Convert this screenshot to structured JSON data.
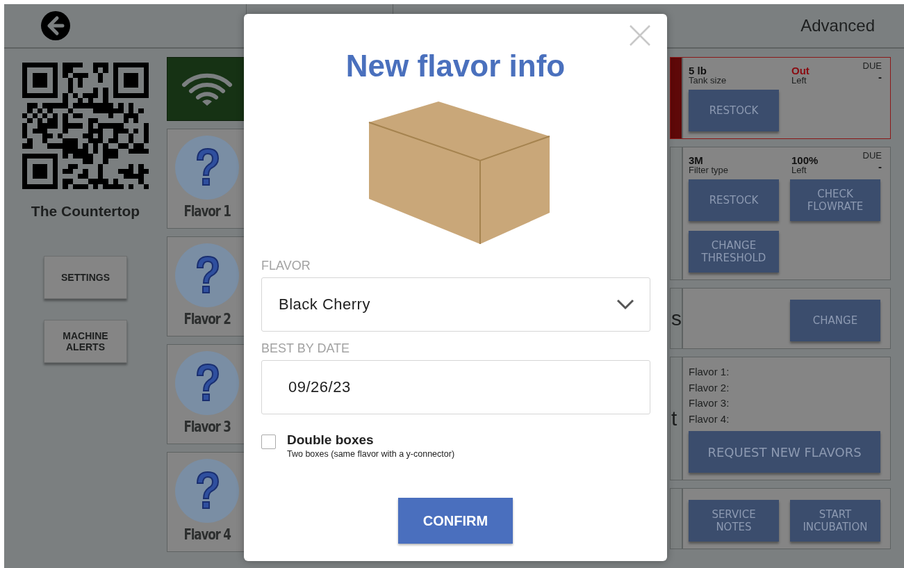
{
  "header": {
    "title": "Advanced"
  },
  "machine": {
    "name": "The Countertop"
  },
  "side_buttons": [
    "SETTINGS",
    "MACHINE ALERTS"
  ],
  "flavor_tiles": [
    {
      "label": "Flavor 1"
    },
    {
      "label": "Flavor 2"
    },
    {
      "label": "Flavor 3"
    },
    {
      "label": "Flavor 4"
    }
  ],
  "cards": [
    {
      "kind": "supply",
      "alert": true,
      "size": "5 lb",
      "size_label": "Tank size",
      "remaining": "Out",
      "remaining_label": "Left",
      "due_label": "DUE",
      "due": "-",
      "buttons": [
        "RESTOCK"
      ]
    },
    {
      "kind": "supply",
      "alert": false,
      "size": "3M",
      "size_label": "Filter type",
      "remaining": "100%",
      "remaining_label": "Left",
      "due_label": "DUE",
      "due": "-",
      "buttons": [
        "RESTOCK",
        "CHECK FLOWRATE",
        "CHANGE THRESHOLD"
      ]
    },
    {
      "kind": "setting",
      "label_fragment": "s",
      "buttons": [
        "CHANGE"
      ]
    },
    {
      "kind": "flavors",
      "label_fragment": "t",
      "lines": [
        "Flavor 1:",
        "Flavor 2:",
        "Flavor 3:",
        "Flavor 4:"
      ],
      "buttons": [
        "REQUEST NEW FLAVORS"
      ]
    },
    {
      "kind": "action",
      "buttons": [
        "SERVICE NOTES",
        "START INCUBATION"
      ]
    }
  ],
  "dialog": {
    "title": "New flavor info",
    "fields": [
      {
        "kind": "select",
        "label": "FLAVOR",
        "value": "Black Cherry"
      },
      {
        "kind": "text",
        "label": "BEST BY DATE",
        "value": "09/26/23"
      }
    ],
    "option": {
      "label": "Double boxes",
      "description": "Two boxes (same flavor with a y-connector)",
      "checked": false
    },
    "confirm": "CONFIRM"
  }
}
